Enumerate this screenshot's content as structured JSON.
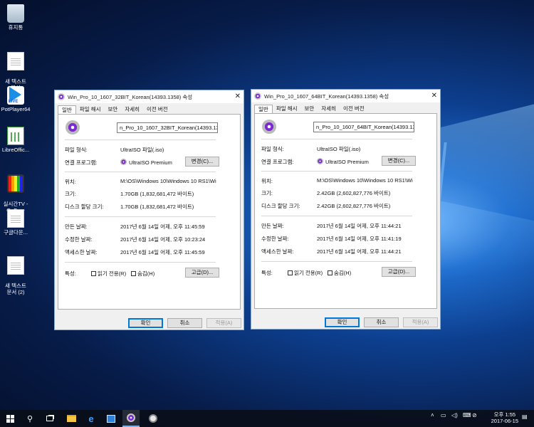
{
  "desktop": {
    "icons": [
      {
        "label": "휴지통"
      },
      {
        "label": "새 텍스트\n문서"
      },
      {
        "label": "PotPlayer64"
      },
      {
        "label": "LibreOffic..."
      },
      {
        "label": "실시간TV -\nOnFree"
      },
      {
        "label": "구글다운..."
      },
      {
        "label": "새 텍스트\n문서 (2)"
      }
    ]
  },
  "dialog1": {
    "title": "Win_Pro_10_1607_32BIT_Korean(14393.1358) 속성",
    "tabs": [
      "일반",
      "파일 해시",
      "보안",
      "자세히",
      "이전 버전"
    ],
    "filename": "n_Pro_10_1607_32BIT_Korean(14393.1358)",
    "labels": {
      "type": "파일 형식:",
      "opens_with": "연결 프로그램:",
      "location": "위치:",
      "size": "크기:",
      "size_on_disk": "디스크 할당 크기:",
      "created": "만든 날짜:",
      "modified": "수정한 날짜:",
      "accessed": "액세스한 날짜:",
      "attributes": "특성:"
    },
    "values": {
      "type": "UltraISO 파일(.iso)",
      "opens_with": "UltraISO Premium",
      "location": "M:\\OS\\Windows 10\\Windows 10 RS1\\Wi",
      "size": "1.70GB (1,832,681,472 바이트)",
      "size_on_disk": "1.70GB (1,832,681,472 바이트)",
      "created": "2017년 6월 14일 어제, 오후 11:45:59",
      "modified": "2017년 6월 14일 어제, 오후 10:23:24",
      "accessed": "2017년 6월 14일 어제, 오후 11:45:59"
    },
    "buttons": {
      "change": "변경(C)...",
      "advanced": "고급(D)...",
      "ok": "확인",
      "cancel": "취소",
      "apply": "적용(A)"
    },
    "checkboxes": {
      "readonly": "읽기 전용(R)",
      "hidden": "숨김(H)"
    }
  },
  "dialog2": {
    "title": "Win_Pro_10_1607_64BIT_Korean(14393.1358) 속성",
    "tabs": [
      "일반",
      "파일 해시",
      "보안",
      "자세히",
      "이전 버전"
    ],
    "filename": "n_Pro_10_1607_64BIT_Korean(14393.1358)",
    "labels": {
      "type": "파일 형식:",
      "opens_with": "연결 프로그램:",
      "location": "위치:",
      "size": "크기:",
      "size_on_disk": "디스크 할당 크기:",
      "created": "만든 날짜:",
      "modified": "수정한 날짜:",
      "accessed": "액세스한 날짜:",
      "attributes": "특성:"
    },
    "values": {
      "type": "UltraISO 파일(.iso)",
      "opens_with": "UltraISO Premium",
      "location": "M:\\OS\\Windows 10\\Windows 10 RS1\\Wi",
      "size": "2.42GB (2,602,827,776 바이트)",
      "size_on_disk": "2.42GB (2,602,827,776 바이트)",
      "created": "2017년 6월 14일 어제, 오후 11:44:21",
      "modified": "2017년 6월 14일 어제, 오후 11:41:19",
      "accessed": "2017년 6월 14일 어제, 오후 11:44:21"
    },
    "buttons": {
      "change": "변경(C)...",
      "advanced": "고급(D)...",
      "ok": "확인",
      "cancel": "취소",
      "apply": "적용(A)"
    },
    "checkboxes": {
      "readonly": "읽기 전용(R)",
      "hidden": "숨김(H)"
    }
  },
  "taskbar": {
    "icons": [
      "start-icon",
      "search-icon",
      "task-view-icon",
      "file-explorer-icon",
      "edge-icon",
      "store-icon",
      "ultraiso-icon",
      "app-icon"
    ],
    "clock_time": "오후 1:55",
    "clock_date": "2017-06-15"
  }
}
